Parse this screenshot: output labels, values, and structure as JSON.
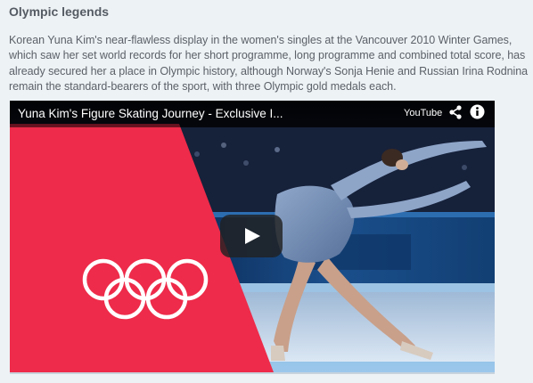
{
  "article": {
    "heading": "Olympic legends",
    "paragraph": "Korean Yuna Kim's near-flawless display in the women's singles at the Vancouver 2010 Winter Games, which saw her set world records for her short programme, long programme and combined total score, has already secured her a place in Olympic history, although Norway's Sonja Henie and Russian Irina Rodnina remain the standard-bearers of the sport, with three Olympic gold medals each."
  },
  "video": {
    "title": "Yuna Kim's Figure Skating Journey - Exclusive I...",
    "brand": "YouTube",
    "icons": {
      "share": "share-icon",
      "info": "info-icon",
      "play": "play-icon",
      "rings": "olympic-rings-logo"
    },
    "colors": {
      "accent_red": "#ee2b4a",
      "ice": "#dbe8f5",
      "dark_bg": "#0b1020"
    }
  }
}
